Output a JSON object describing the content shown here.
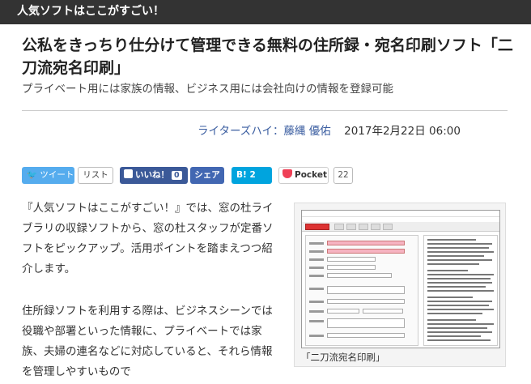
{
  "banner": {
    "text": "人気ソフトはここがすごい！"
  },
  "article": {
    "title": "公私をきっちり仕分けて管理できる無料の住所録・宛名印刷ソフト「二刀流宛名印刷」",
    "subtitle": "プライベート用には家族の情報、ビジネス用には会社向けの情報を登録可能",
    "byline": {
      "prefix": "ライターズハイ：",
      "author": "藤縄 優佑",
      "date": "2017年2月22日 06:00"
    },
    "paragraphs": [
      "『人気ソフトはここがすごい！』では、窓の杜ライブラリの収録ソフトから、窓の杜スタッフが定番ソフトをピックアップ。活用ポイントを踏まえつつ紹介します。",
      "住所録ソフトを利用する際は、ビジネスシーンでは役職や部署といった情報に、プライベートでは家族、夫婦の連名などに対応していると、それら情報を管理しやすいもので"
    ],
    "figure_caption": "「二刀流宛名印刷」"
  },
  "share": {
    "tweet_label": "ツイート",
    "list_label": "リスト",
    "like_label": "いいね！",
    "like_count": "0",
    "fb_share_label": "シェア",
    "hatena_label": "B!",
    "hatena_count": "2",
    "pocket_label": "Pocket",
    "pocket_count": "22"
  },
  "colors": {
    "banner_bg": "#333333",
    "twitter": "#55acee",
    "facebook": "#3b5998",
    "hatena": "#00a4de",
    "pocket": "#ef4056",
    "link": "#3a5da0"
  }
}
